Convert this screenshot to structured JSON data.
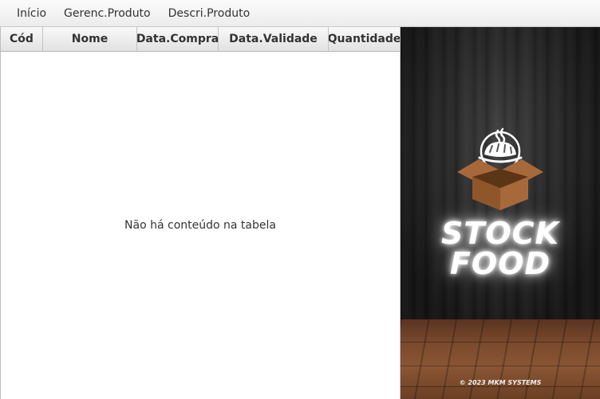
{
  "menu": {
    "items": [
      {
        "label": "Início"
      },
      {
        "label": "Gerenc.Produto"
      },
      {
        "label": "Descri.Produto"
      }
    ]
  },
  "table": {
    "columns": [
      {
        "label": "Cód"
      },
      {
        "label": "Nome"
      },
      {
        "label": "Data.Compra"
      },
      {
        "label": "Data.Validade"
      },
      {
        "label": "Quantidade"
      }
    ],
    "rows": [],
    "empty_message": "Não há conteúdo na tabela"
  },
  "brand": {
    "title_line1": "STOCK",
    "title_line2": "FOOD",
    "copyright": "© 2023 MKM SYSTEMS",
    "logo_icon": "bread-box-icon",
    "colors": {
      "box": "#a7693a",
      "box_dark": "#7d4a24",
      "glow": "#ffffff"
    }
  }
}
